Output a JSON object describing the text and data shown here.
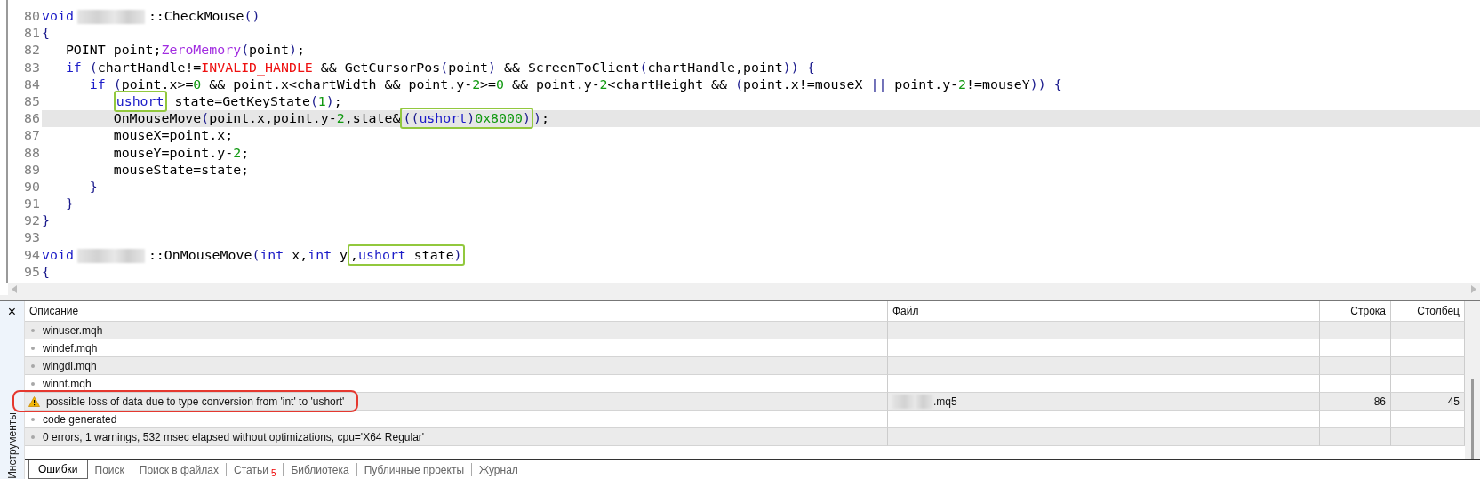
{
  "editor": {
    "lines": [
      {
        "number": "80",
        "current": false,
        "tokens": [
          {
            "kind": "keyword",
            "t": "void"
          },
          {
            "kind": "redacted"
          },
          {
            "kind": "text",
            "t": "::CheckMouse"
          },
          {
            "kind": "punct",
            "t": "()"
          }
        ]
      },
      {
        "number": "81",
        "current": false,
        "tokens": [
          {
            "kind": "punct",
            "t": "{"
          }
        ]
      },
      {
        "number": "82",
        "current": false,
        "tokens": [
          {
            "kind": "text",
            "t": "   POINT point;"
          },
          {
            "kind": "function",
            "t": "ZeroMemory"
          },
          {
            "kind": "punct",
            "t": "("
          },
          {
            "kind": "text",
            "t": "point"
          },
          {
            "kind": "punct",
            "t": ")"
          },
          {
            "kind": "text",
            "t": ";"
          }
        ]
      },
      {
        "number": "83",
        "current": false,
        "tokens": [
          {
            "kind": "keyword",
            "t": "   if"
          },
          {
            "kind": "punct",
            "t": " ("
          },
          {
            "kind": "text",
            "t": "chartHandle!="
          },
          {
            "kind": "constant",
            "t": "INVALID_HANDLE"
          },
          {
            "kind": "text",
            "t": " && GetCursorPos"
          },
          {
            "kind": "punct",
            "t": "("
          },
          {
            "kind": "text",
            "t": "point"
          },
          {
            "kind": "punct",
            "t": ")"
          },
          {
            "kind": "text",
            "t": " && ScreenToClient"
          },
          {
            "kind": "punct",
            "t": "("
          },
          {
            "kind": "text",
            "t": "chartHandle,point"
          },
          {
            "kind": "punct",
            "t": ")) {"
          }
        ]
      },
      {
        "number": "84",
        "current": false,
        "tokens": [
          {
            "kind": "keyword",
            "t": "      if"
          },
          {
            "kind": "punct",
            "t": " ("
          },
          {
            "kind": "text",
            "t": "point.x>="
          },
          {
            "kind": "number",
            "t": "0"
          },
          {
            "kind": "text",
            "t": " && point.x<chartWidth && point.y-"
          },
          {
            "kind": "number",
            "t": "2"
          },
          {
            "kind": "text",
            "t": ">="
          },
          {
            "kind": "number",
            "t": "0"
          },
          {
            "kind": "text",
            "t": " && point.y-"
          },
          {
            "kind": "number",
            "t": "2"
          },
          {
            "kind": "text",
            "t": "<chartHeight && "
          },
          {
            "kind": "punct",
            "t": "("
          },
          {
            "kind": "text",
            "t": "point.x!=mouseX "
          },
          {
            "kind": "punct",
            "t": "||"
          },
          {
            "kind": "text",
            "t": " point.y-"
          },
          {
            "kind": "number",
            "t": "2"
          },
          {
            "kind": "text",
            "t": "!=mouseY"
          },
          {
            "kind": "punct",
            "t": ")) {"
          }
        ]
      },
      {
        "number": "85",
        "current": false,
        "kind": "indented",
        "tokens": [
          {
            "kind": "box",
            "tokens": [
              {
                "kind": "keyword",
                "t": "ushort"
              }
            ]
          },
          {
            "kind": "text",
            "t": " state=GetKeyState"
          },
          {
            "kind": "punct",
            "t": "("
          },
          {
            "kind": "number",
            "t": "1"
          },
          {
            "kind": "punct",
            "t": ")"
          },
          {
            "kind": "text",
            "t": ";"
          }
        ]
      },
      {
        "number": "86",
        "current": true,
        "tokens": [
          {
            "kind": "text",
            "t": "         OnMouseMove"
          },
          {
            "kind": "punct",
            "t": "("
          },
          {
            "kind": "text",
            "t": "point.x,point.y-"
          },
          {
            "kind": "number",
            "t": "2"
          },
          {
            "kind": "text",
            "t": ",state&"
          },
          {
            "kind": "box",
            "tokens": [
              {
                "kind": "punct",
                "t": "(("
              },
              {
                "kind": "keyword",
                "t": "ushort"
              },
              {
                "kind": "punct",
                "t": ")"
              },
              {
                "kind": "number",
                "t": "0x8000"
              },
              {
                "kind": "punct",
                "t": ")"
              }
            ]
          },
          {
            "kind": "punct",
            "t": ")"
          },
          {
            "kind": "text",
            "t": ";"
          }
        ]
      },
      {
        "number": "87",
        "current": false,
        "tokens": [
          {
            "kind": "text",
            "t": "         mouseX=point.x;"
          }
        ]
      },
      {
        "number": "88",
        "current": false,
        "tokens": [
          {
            "kind": "text",
            "t": "         mouseY=point.y-"
          },
          {
            "kind": "number",
            "t": "2"
          },
          {
            "kind": "text",
            "t": ";"
          }
        ]
      },
      {
        "number": "89",
        "current": false,
        "tokens": [
          {
            "kind": "text",
            "t": "         mouseState=state;"
          }
        ]
      },
      {
        "number": "90",
        "current": false,
        "tokens": [
          {
            "kind": "punct",
            "t": "      }"
          }
        ]
      },
      {
        "number": "91",
        "current": false,
        "tokens": [
          {
            "kind": "punct",
            "t": "   }"
          }
        ]
      },
      {
        "number": "92",
        "current": false,
        "tokens": [
          {
            "kind": "punct",
            "t": "}"
          }
        ]
      },
      {
        "number": "93",
        "current": false
      },
      {
        "number": "94",
        "current": false,
        "tokens": [
          {
            "kind": "keyword",
            "t": "void"
          },
          {
            "kind": "redacted"
          },
          {
            "kind": "text",
            "t": "::OnMouseMove"
          },
          {
            "kind": "punct",
            "t": "("
          },
          {
            "kind": "keyword",
            "t": "int"
          },
          {
            "kind": "text",
            "t": " x,"
          },
          {
            "kind": "keyword",
            "t": "int"
          },
          {
            "kind": "text",
            "t": " y"
          },
          {
            "kind": "box",
            "tokens": [
              {
                "kind": "text",
                "t": ","
              },
              {
                "kind": "keyword",
                "t": "ushort"
              },
              {
                "kind": "text",
                "t": " state"
              },
              {
                "kind": "punct",
                "t": ")"
              }
            ]
          }
        ]
      },
      {
        "number": "95",
        "current": false,
        "tokens": [
          {
            "kind": "punct",
            "t": "{"
          }
        ]
      }
    ]
  },
  "toolbox": {
    "close": "×",
    "title": "Инструменты",
    "table": {
      "columns": [
        "Описание",
        "Файл",
        "Строка",
        "Столбец"
      ],
      "rows": [
        {
          "kind": "info",
          "description": "winuser.mqh",
          "boxed": false
        },
        {
          "kind": "info",
          "description": "windef.mqh",
          "boxed": false
        },
        {
          "kind": "info",
          "description": "wingdi.mqh",
          "boxed": false
        },
        {
          "kind": "info",
          "description": "winnt.mqh",
          "boxed": false
        },
        {
          "kind": "warning",
          "description": "possible loss of data due to type conversion from 'int' to 'ushort'",
          "file": {
            "redacted": true,
            "text": ".mq5"
          },
          "line": "86",
          "column": "45",
          "boxed": true
        },
        {
          "kind": "info",
          "description": "code generated",
          "boxed": false
        },
        {
          "kind": "info",
          "description": "0 errors, 1 warnings, 532 msec elapsed without optimizations, cpu='X64 Regular'",
          "boxed": false
        }
      ]
    },
    "tabs": [
      {
        "label": "Ошибки",
        "selected": true
      },
      {
        "label": "Поиск",
        "selected": false
      },
      {
        "label": "Поиск в файлах",
        "selected": false
      },
      {
        "label": "Статьи",
        "badge": "5",
        "selected": false
      },
      {
        "label": "Библиотека",
        "selected": false
      },
      {
        "label": "Публичные проекты",
        "selected": false
      },
      {
        "label": "Журнал",
        "selected": false
      }
    ]
  }
}
